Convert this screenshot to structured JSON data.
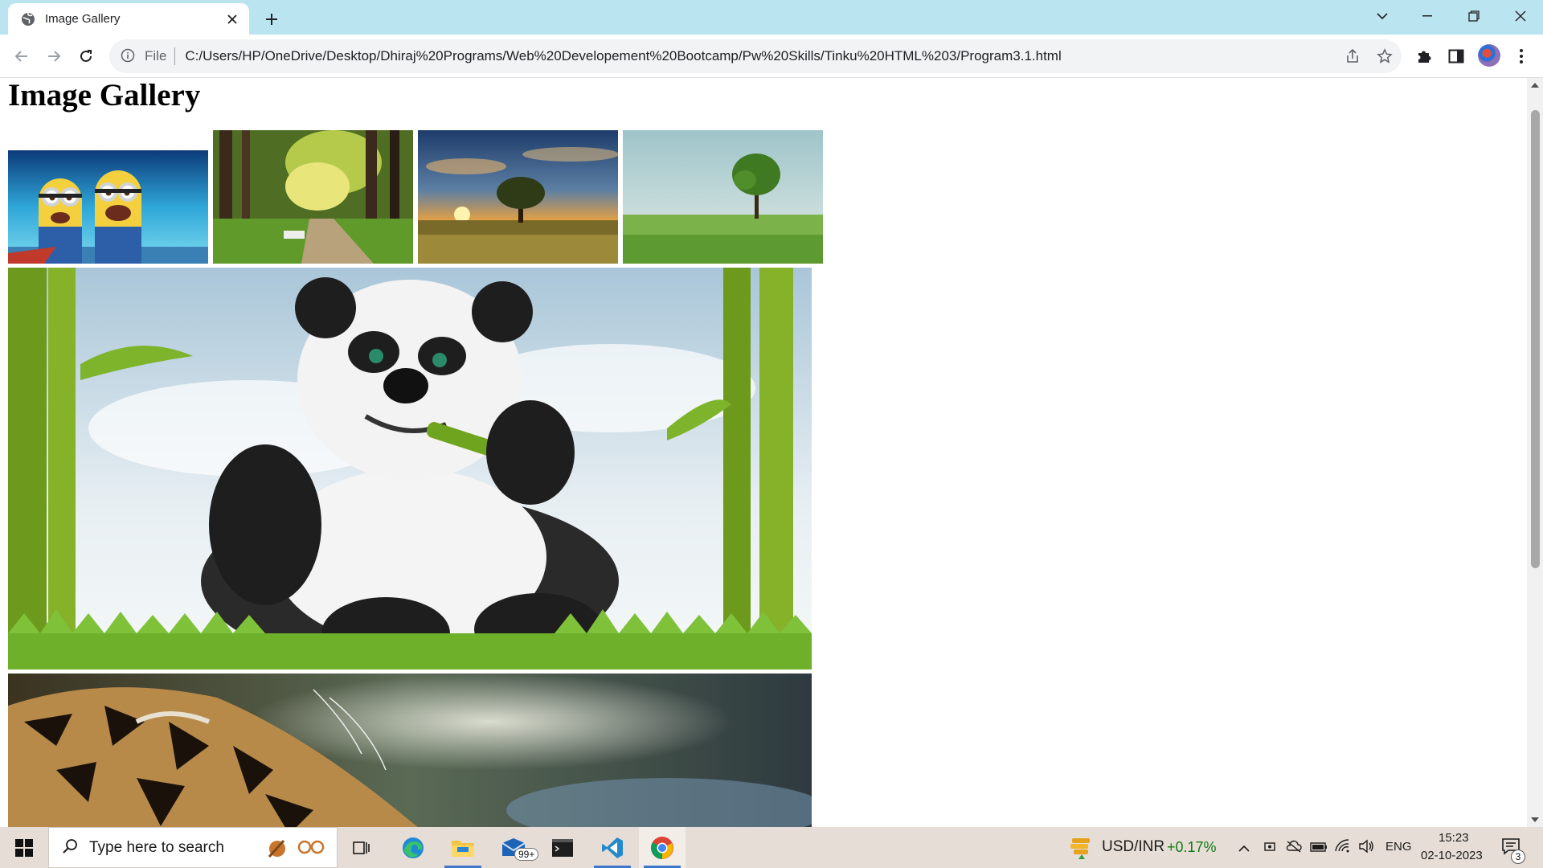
{
  "browser": {
    "tab": {
      "title": "Image Gallery"
    },
    "omnibox": {
      "scheme_label": "File",
      "url": "C:/Users/HP/OneDrive/Desktop/Dhiraj%20Programs/Web%20Developement%20Bootcamp/Pw%20Skills/Tinku%20HTML%203/Program3.1.html"
    }
  },
  "page": {
    "heading": "Image Gallery",
    "images": [
      {
        "subject": "minions"
      },
      {
        "subject": "forest-path"
      },
      {
        "subject": "sunset-tree"
      },
      {
        "subject": "tree-in-meadow"
      },
      {
        "subject": "panda-eating-bamboo"
      },
      {
        "subject": "tiger-closeup"
      }
    ]
  },
  "taskbar": {
    "search_placeholder": "Type here to search",
    "mail_badge": "99+",
    "ticker": {
      "symbol": "USD/INR",
      "change": "+0.17%",
      "change_color": "#0f7b0f"
    },
    "language": "ENG",
    "time": "15:23",
    "date": "02-10-2023",
    "notification_count": "3"
  },
  "colors": {
    "tab_strip": "#b9e4f0",
    "taskbar": "#e6ddd6"
  }
}
